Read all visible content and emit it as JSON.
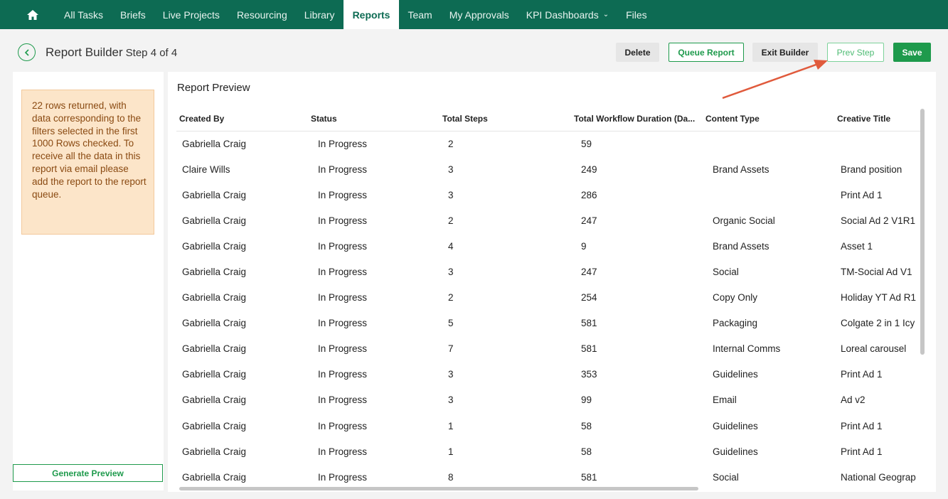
{
  "nav": {
    "items": [
      {
        "label": "All Tasks",
        "active": false
      },
      {
        "label": "Briefs",
        "active": false
      },
      {
        "label": "Live Projects",
        "active": false
      },
      {
        "label": "Resourcing",
        "active": false
      },
      {
        "label": "Library",
        "active": false
      },
      {
        "label": "Reports",
        "active": true
      },
      {
        "label": "Team",
        "active": false
      },
      {
        "label": "My Approvals",
        "active": false
      },
      {
        "label": "KPI Dashboards",
        "active": false,
        "has_dropdown": true
      },
      {
        "label": "Files",
        "active": false
      }
    ],
    "home_icon": "home-icon"
  },
  "header": {
    "title": "Report Builder",
    "step": "Step 4 of 4",
    "buttons": {
      "delete": "Delete",
      "queue_report": "Queue Report",
      "exit_builder": "Exit Builder",
      "prev_step": "Prev Step",
      "save": "Save"
    }
  },
  "sidebar": {
    "notice": "22 rows returned, with data corresponding to the filters selected in the first 1000 Rows checked. To receive all the data in this report via email please add the report to the report queue.",
    "generate_preview": "Generate Preview"
  },
  "preview": {
    "title": "Report Preview",
    "columns": [
      "Created By",
      "Status",
      "Total Steps",
      "Total Workflow Duration (Da...",
      "Content Type",
      "Creative Title"
    ],
    "rows": [
      [
        "Gabriella Craig",
        "In Progress",
        "2",
        "59",
        "",
        ""
      ],
      [
        "Claire Wills",
        "In Progress",
        "3",
        "249",
        "Brand Assets",
        "Brand position"
      ],
      [
        "Gabriella Craig",
        "In Progress",
        "3",
        "286",
        "",
        "Print Ad 1"
      ],
      [
        "Gabriella Craig",
        "In Progress",
        "2",
        "247",
        "Organic Social",
        "Social Ad 2 V1R1"
      ],
      [
        "Gabriella Craig",
        "In Progress",
        "4",
        "9",
        "Brand Assets",
        "Asset 1"
      ],
      [
        "Gabriella Craig",
        "In Progress",
        "3",
        "247",
        "Social",
        "TM-Social Ad V1"
      ],
      [
        "Gabriella Craig",
        "In Progress",
        "2",
        "254",
        "Copy Only",
        "Holiday YT Ad R1"
      ],
      [
        "Gabriella Craig",
        "In Progress",
        "5",
        "581",
        "Packaging",
        "Colgate 2 in 1 Icy"
      ],
      [
        "Gabriella Craig",
        "In Progress",
        "7",
        "581",
        "Internal Comms",
        "Loreal carousel"
      ],
      [
        "Gabriella Craig",
        "In Progress",
        "3",
        "353",
        "Guidelines",
        "Print Ad 1"
      ],
      [
        "Gabriella Craig",
        "In Progress",
        "3",
        "99",
        "Email",
        "Ad v2"
      ],
      [
        "Gabriella Craig",
        "In Progress",
        "1",
        "58",
        "Guidelines",
        "Print Ad 1"
      ],
      [
        "Gabriella Craig",
        "In Progress",
        "1",
        "58",
        "Guidelines",
        "Print Ad 1"
      ],
      [
        "Gabriella Craig",
        "In Progress",
        "8",
        "581",
        "Social",
        "National Geograp"
      ]
    ]
  },
  "colors": {
    "nav_bg": "#0d6b53",
    "accent_green": "#1e9a4c",
    "notice_bg": "#fce5c9",
    "notice_text": "#8a4a12",
    "annotation_arrow": "#e05a3c"
  }
}
